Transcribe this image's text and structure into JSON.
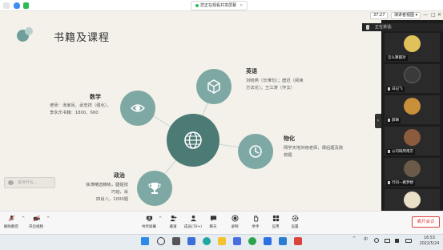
{
  "topbar": {
    "share_notice": "您正在观看共享屏幕",
    "share_notice_close": "×"
  },
  "meeting": {
    "timer": "37:27",
    "view_label": "演讲者视图"
  },
  "window_controls": {
    "minimize": "—",
    "maximize": "□",
    "close": "✕"
  },
  "slide": {
    "title": "书籍及课程",
    "topics": [
      {
        "title": "英语",
        "desc_lines": [
          "刘晓燕（长难句）；唐迟（阅读",
          "方法论）；王江涛（作文）"
        ],
        "icon": "box-icon"
      },
      {
        "title": "数学",
        "desc_lines": [
          "老师：汤家凤、武忠祥（强化），",
          "李永乐书籍：1800、660"
        ],
        "icon": "eye-icon"
      },
      {
        "title": "物化",
        "desc_lines": [
          "网学天地刘晓老师，课后题及院",
          "校题"
        ],
        "icon": "clock-icon"
      },
      {
        "title": "政治",
        "desc_lines": [
          "徐涛精选精练，腿姐技巧班，肖",
          "四肖八，1000题"
        ],
        "icon": "trophy-icon"
      }
    ],
    "center_icon": "globe-icon"
  },
  "chat_float": {
    "text": "说点什么..."
  },
  "expand_tab": "›",
  "panel": {
    "speaking_label": "正在讲话:",
    "participants": [
      {
        "name": "怎么算都对",
        "color": "#e0c15a"
      },
      {
        "name": "日记飞",
        "color": "#3a3a3a"
      },
      {
        "name": "薛琳",
        "color": "#c9903b"
      },
      {
        "name": "公司研所南京",
        "color": "#8c5a3c"
      },
      {
        "name": "行问一路梦想",
        "color": "#6a5a48"
      },
      {
        "name": "",
        "color": "#e9e1c7"
      }
    ]
  },
  "toolbar": {
    "buttons": [
      {
        "label": "解除静音",
        "icon": "mic-muted-icon"
      },
      {
        "label": "开启视频",
        "icon": "camera-off-icon"
      },
      {
        "label": "共享屏幕",
        "icon": "share-screen-icon"
      },
      {
        "label": "邀请",
        "icon": "invite-icon"
      },
      {
        "label": "成员(70+)",
        "icon": "members-icon"
      },
      {
        "label": "聊天",
        "icon": "chat-icon"
      },
      {
        "label": "录制",
        "icon": "record-icon"
      },
      {
        "label": "举手",
        "icon": "raise-hand-icon"
      },
      {
        "label": "应用",
        "icon": "apps-icon"
      },
      {
        "label": "设置",
        "icon": "settings-icon"
      }
    ],
    "leave_label": "离开会议"
  },
  "taskbar": {
    "ime": "中",
    "clock_time": "16:53",
    "clock_date": "2022/5/24"
  },
  "colors": {
    "accent": "#4c7a74",
    "topic_circle": "#7ea8a3",
    "leave_red": "#e0403f",
    "slide_bg": "#f4f1ea"
  }
}
